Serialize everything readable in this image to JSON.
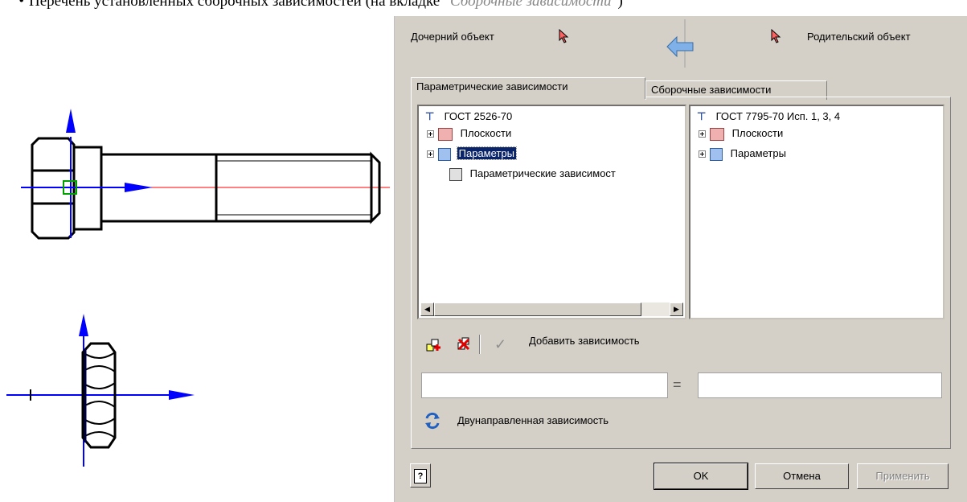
{
  "caption": {
    "bullet": "•",
    "text": "Перечень установленных сборочных зависимостей (на вкладке ",
    "italic": "\"Сборочные зависимости\"",
    "end": ")"
  },
  "dialog": {
    "child_label": "Дочерний объект",
    "parent_label": "Родительский объект",
    "tabs": [
      "Параметрические зависимости",
      "Сборочные зависимости"
    ],
    "left_tree": {
      "root": "ГОСТ 2526-70",
      "items": [
        "Плоскости",
        "Параметры",
        "Параметрические зависимост"
      ]
    },
    "right_tree": {
      "root": "ГОСТ 7795-70 Исп. 1, 3, 4",
      "items": [
        "Плоскости",
        "Параметры"
      ]
    },
    "add_dependency": "Добавить зависимость",
    "equals": "=",
    "bidirectional": "Двунаправленная зависимость",
    "buttons": {
      "help": "?",
      "ok": "OK",
      "cancel": "Отмена",
      "apply": "Применить"
    }
  },
  "colors": {
    "dialog_bg": "#d4d0c8",
    "selection": "#0a246a",
    "axis_blue": "#0000ff",
    "axis_red": "#ff0000"
  }
}
